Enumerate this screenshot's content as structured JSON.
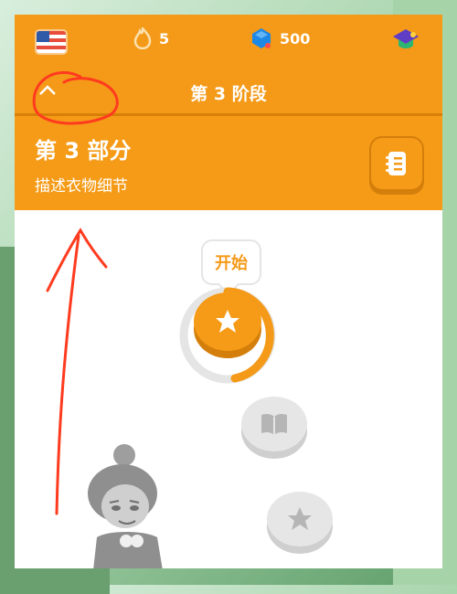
{
  "header": {
    "flag_icon": "us-flag-icon",
    "streak_count": "5",
    "gems_count": "500",
    "chevron_icon": "chevron-up-icon",
    "stage_title": "第 3 阶段"
  },
  "section": {
    "title": "第 3 部分",
    "subtitle": "描述衣物细节",
    "guide_icon": "notebook-icon"
  },
  "path": {
    "start_label": "开始",
    "nodes": [
      "star-icon",
      "book-icon",
      "star-icon"
    ],
    "start_progress": 0.6
  },
  "colors": {
    "accent": "#f49a18",
    "accent_dark": "#d47e0b",
    "locked": "#e6e6e6",
    "annotation": "#ff3b1f"
  }
}
